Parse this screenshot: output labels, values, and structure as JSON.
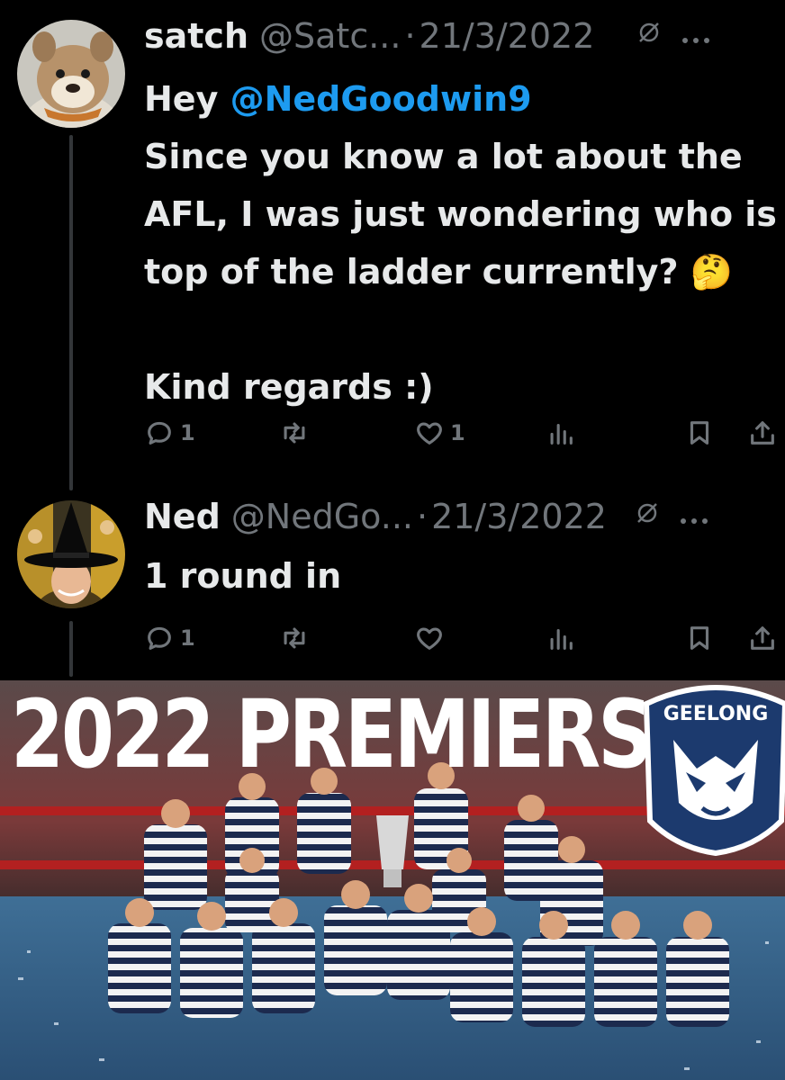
{
  "tweets": [
    {
      "name": "satch",
      "handle": "@Satc...",
      "separator": "·",
      "date": "21/3/2022",
      "body_prefix": "Hey ",
      "mention": "@NedGoodwin9",
      "body_lines": [
        "Since you know a lot about the",
        "AFL, I was just wondering who is",
        "top of the ladder currently? 🤔",
        "",
        "Kind regards :)"
      ],
      "reply_count": "1",
      "retweet_count": "",
      "like_count": "1"
    },
    {
      "name": "Ned",
      "handle": "@NedGo...",
      "separator": "·",
      "date": "21/3/2022",
      "body_lines": [
        "1 round in"
      ],
      "reply_count": "1",
      "retweet_count": "",
      "like_count": ""
    }
  ],
  "icons": {
    "reply": "reply-icon",
    "retweet": "retweet-icon",
    "like": "like-icon",
    "views": "views-icon",
    "bookmark": "bookmark-icon",
    "share": "share-icon",
    "mute": "mute-icon",
    "more": "more-icon"
  },
  "photo": {
    "headline": "2022 PREMIERS",
    "badge_text": "GEELONG",
    "colors": {
      "navy": "#1c3a6e",
      "white": "#ffffff",
      "pitch": "#2d5d8c"
    }
  },
  "colors": {
    "background": "#000000",
    "text": "#e7e9ea",
    "muted": "#71767b",
    "link": "#1d9bf0"
  }
}
